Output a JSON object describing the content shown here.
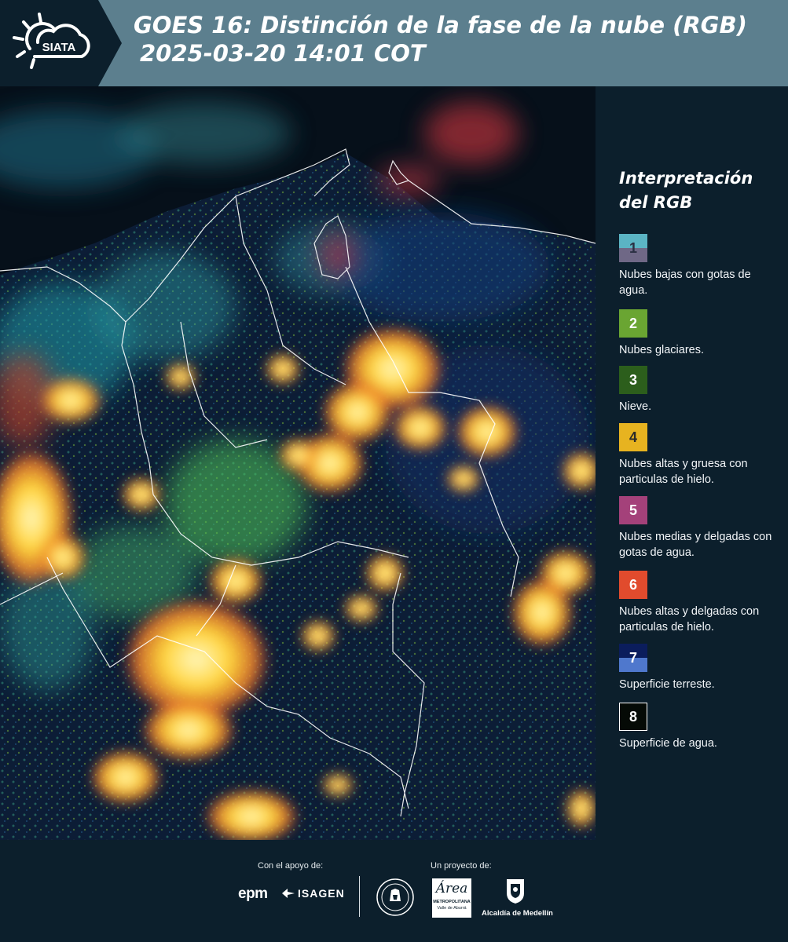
{
  "header": {
    "logo_text": "SIATA",
    "title_line1": "GOES 16: Distinción de la fase de la nube (RGB)",
    "title_line2": "2025-03-20 14:01 COT"
  },
  "legend": {
    "title_line1": "Interpretación",
    "title_line2": "del RGB",
    "items": [
      {
        "num": "1",
        "text": "Nubes bajas con gotas de agua.",
        "color_top": "#5bb4c4",
        "color_bottom": "#6f6886"
      },
      {
        "num": "2",
        "text": "Nubes glaciares.",
        "color": "#6aa532"
      },
      {
        "num": "3",
        "text": "Nieve.",
        "color": "#2c5e1c"
      },
      {
        "num": "4",
        "text": "Nubes altas y gruesa con particulas de hielo.",
        "color": "#e7b320"
      },
      {
        "num": "5",
        "text": "Nubes medias y delgadas con gotas de agua.",
        "color": "#a4417a"
      },
      {
        "num": "6",
        "text": "Nubes altas y delgadas con particulas de hielo.",
        "color": "#e14b2d"
      },
      {
        "num": "7",
        "text": "Superficie terreste.",
        "color_top": "#0b1d5c",
        "color_bottom": "#4f78cd"
      },
      {
        "num": "8",
        "text": "Superficie de agua.",
        "color": "#050a06"
      }
    ]
  },
  "footer": {
    "support_label": "Con el apoyo de:",
    "project_label": "Un proyecto de:",
    "epm": "epm",
    "isagen": "ISAGEN",
    "area_name": "Área",
    "area_line1": "METROPOLITANA",
    "area_line2": "Valle de Aburrá",
    "alcaldia": "Alcaldía de Medellín"
  }
}
